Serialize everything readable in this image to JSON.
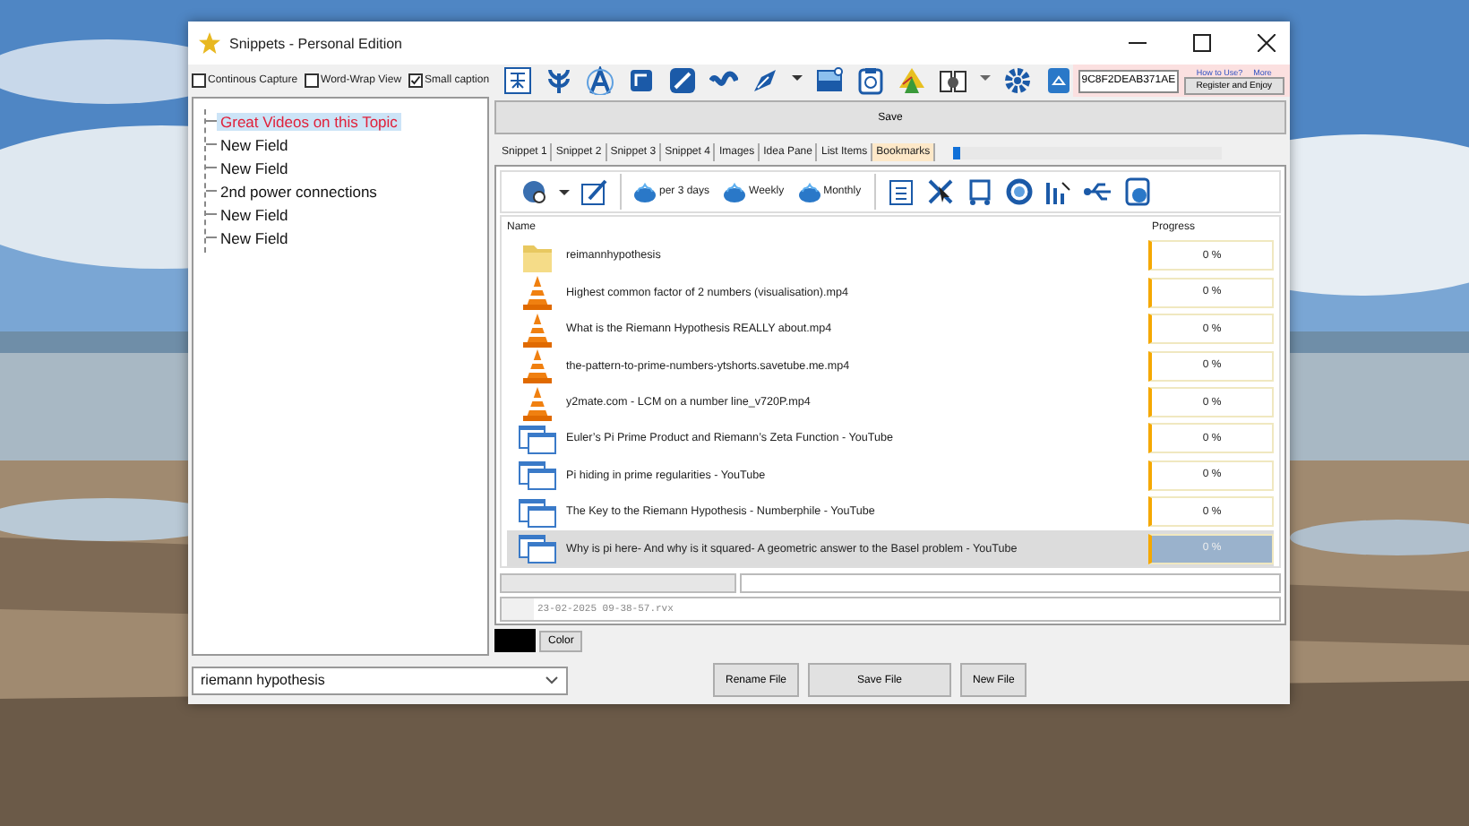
{
  "window": {
    "title": "Snippets - Personal Edition"
  },
  "options": [
    {
      "label": "Continous Capture",
      "checked": false
    },
    {
      "label": "Word-Wrap View",
      "checked": false
    },
    {
      "label": "Small caption",
      "checked": true
    }
  ],
  "registration": {
    "serial": "9C8F2DEAB371AE",
    "links": [
      "How to Use?",
      "More"
    ],
    "button": "Register and Enjoy"
  },
  "tree": [
    {
      "label": "Great Videos on this Topic",
      "selected": true
    },
    {
      "label": "New Field",
      "selected": false
    },
    {
      "label": "New Field",
      "selected": false
    },
    {
      "label": "2nd power connections",
      "selected": false
    },
    {
      "label": "New Field",
      "selected": false
    },
    {
      "label": "New Field",
      "selected": false
    }
  ],
  "save_button": "Save",
  "tabs": [
    {
      "label": "Snippet 1",
      "selected": false
    },
    {
      "label": "Snippet 2",
      "selected": false
    },
    {
      "label": "Snippet 3",
      "selected": false
    },
    {
      "label": "Snippet 4",
      "selected": false
    },
    {
      "label": "Images",
      "selected": false
    },
    {
      "label": "Idea Pane",
      "selected": false
    },
    {
      "label": "List Items",
      "selected": false
    },
    {
      "label": "Bookmarks",
      "selected": true
    }
  ],
  "tab_slider": {
    "level": 0
  },
  "bookmark_toolbar": {
    "buttons": [
      "per 3 days",
      "Weekly",
      "Monthly"
    ]
  },
  "list": {
    "columns": [
      "Name",
      "Progress"
    ],
    "rows": [
      {
        "kind": "folder",
        "name": "reimannhypothesis",
        "progress": "0 %",
        "level": 0,
        "selected": false
      },
      {
        "kind": "video",
        "name": "Highest common factor of 2 numbers (visualisation).mp4",
        "progress": "0 %",
        "level": 0,
        "selected": false
      },
      {
        "kind": "video",
        "name": "What is the Riemann Hypothesis REALLY about.mp4",
        "progress": "0 %",
        "level": 0,
        "selected": false
      },
      {
        "kind": "video",
        "name": "the-pattern-to-prime-numbers-ytshorts.savetube.me.mp4",
        "progress": "0 %",
        "level": 0,
        "selected": false
      },
      {
        "kind": "video",
        "name": "y2mate.com - LCM on a number line_v720P.mp4",
        "progress": "0 %",
        "level": 0,
        "selected": false
      },
      {
        "kind": "web",
        "name": "Euler’s Pi Prime Product and Riemann’s Zeta Function - YouTube",
        "progress": "0 %",
        "level": 0,
        "selected": false
      },
      {
        "kind": "web",
        "name": "Pi hiding in prime regularities - YouTube",
        "progress": "0 %",
        "level": 0,
        "selected": false
      },
      {
        "kind": "web",
        "name": "The Key to the Riemann Hypothesis - Numberphile - YouTube",
        "progress": "0 %",
        "level": 0,
        "selected": false
      },
      {
        "kind": "web",
        "name": "Why is pi here- And why is it squared- A geometric answer to the Basel problem - YouTube",
        "progress": "0 %",
        "level": 0,
        "selected": true
      }
    ]
  },
  "file_line": "23-02-2025 09-38-57.rvx",
  "color_button": "Color",
  "search_combo": {
    "value": "riemann hypothesis"
  },
  "buttons": [
    "Rename File",
    "Save File",
    "New File"
  ]
}
